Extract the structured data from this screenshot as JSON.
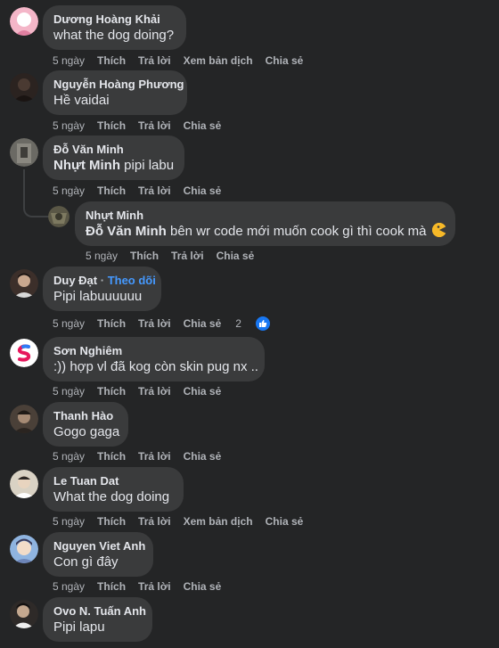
{
  "actions": {
    "time": "5 ngày",
    "like": "Thích",
    "reply": "Trả lời",
    "translate": "Xem bản dịch",
    "share": "Chia sẻ"
  },
  "comments": [
    {
      "name": "Dương Hoàng Khải",
      "text": "what the dog doing?",
      "avatar_color": "#f4b6c8"
    },
    {
      "name": "Nguyễn Hoàng Phương",
      "text": "Hề vaidai",
      "avatar_color": "#2b2320"
    },
    {
      "name": "Đỗ Văn Minh",
      "mention": "Nhựt Minh",
      "text": " pipi labu",
      "avatar_color": "#6b6a64"
    },
    {
      "name": "Nhựt Minh",
      "mention": "Đỗ Văn Minh",
      "text": " bên wr code mới muốn cook gì thì cook mà",
      "avatar_color": "#5a5746",
      "emoji": "pacman-emoji"
    },
    {
      "name": "Duy Đạt",
      "separator": " · ",
      "follow": "Theo dõi",
      "text": "Pipi labuuuuuu",
      "avatar_color": "#3c2f2a",
      "reaction_count": "2"
    },
    {
      "name": "Sơn Nghiêm",
      "text": ":)) hợp vl đã kog còn skin pug nx ..",
      "avatar_color": "#ffffff"
    },
    {
      "name": "Thanh Hào",
      "text": "Gogo gaga",
      "avatar_color": "#4a4038"
    },
    {
      "name": "Le Tuan Dat",
      "text": "What the dog doing",
      "avatar_color": "#d9d2c4"
    },
    {
      "name": "Nguyen Viet Anh",
      "text": "Con gì đây",
      "avatar_color": "#8fb4e0"
    },
    {
      "name": "Ovo N. Tuấn Anh",
      "text": "Pipi lapu",
      "avatar_color": "#2e2a28"
    }
  ]
}
